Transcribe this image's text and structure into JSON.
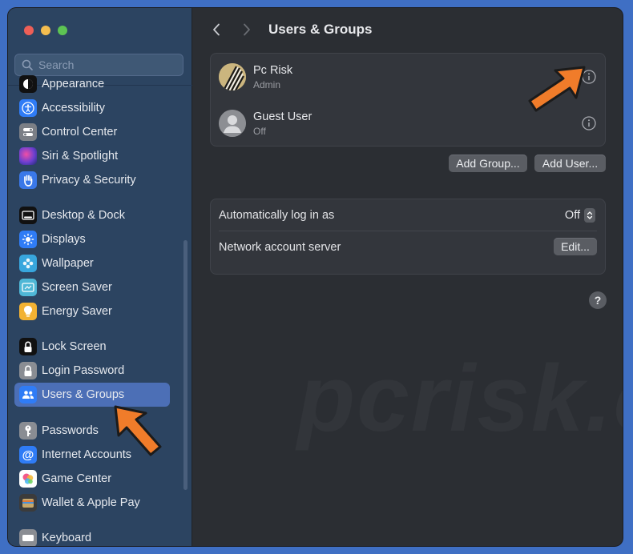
{
  "window": {
    "traffic_lights": [
      "close",
      "minimize",
      "zoom"
    ]
  },
  "sidebar": {
    "search_placeholder": "Search",
    "items": [
      {
        "label": "Appearance",
        "icon": "appearance-icon",
        "color": "#1b1b1b"
      },
      {
        "label": "Accessibility",
        "icon": "accessibility-icon",
        "color": "#2f7cf6"
      },
      {
        "label": "Control Center",
        "icon": "control-center-icon",
        "color": "#7b7f86"
      },
      {
        "label": "Siri & Spotlight",
        "icon": "siri-icon",
        "color": "#6b3fd0"
      },
      {
        "label": "Privacy & Security",
        "icon": "hand-icon",
        "color": "#3a78e8"
      },
      {
        "label": "Desktop & Dock",
        "icon": "dock-icon",
        "color": "#1b1b1b"
      },
      {
        "label": "Displays",
        "icon": "sun-icon",
        "color": "#2f7cf6"
      },
      {
        "label": "Wallpaper",
        "icon": "flower-icon",
        "color": "#38a6dd"
      },
      {
        "label": "Screen Saver",
        "icon": "screen-saver-icon",
        "color": "#4fb7d6"
      },
      {
        "label": "Energy Saver",
        "icon": "bulb-icon",
        "color": "#f2b233"
      },
      {
        "label": "Lock Screen",
        "icon": "lock-icon",
        "color": "#1b1b1b"
      },
      {
        "label": "Login Password",
        "icon": "padlock-icon",
        "color": "#8a8d93"
      },
      {
        "label": "Users & Groups",
        "icon": "users-icon",
        "color": "#2f7cf6"
      },
      {
        "label": "Passwords",
        "icon": "key-icon",
        "color": "#8a8d93"
      },
      {
        "label": "Internet Accounts",
        "icon": "at-icon",
        "color": "#2f7cf6"
      },
      {
        "label": "Game Center",
        "icon": "game-center-icon",
        "color": "#ffffff"
      },
      {
        "label": "Wallet & Apple Pay",
        "icon": "wallet-icon",
        "color": "#3b3b3b"
      },
      {
        "label": "Keyboard",
        "icon": "keyboard-icon",
        "color": "#8a8d93"
      }
    ],
    "active_item": "Users & Groups"
  },
  "header": {
    "title": "Users & Groups"
  },
  "users": [
    {
      "name": "Pc Risk",
      "role": "Admin"
    },
    {
      "name": "Guest User",
      "role": "Off"
    }
  ],
  "buttons": {
    "add_group": "Add Group...",
    "add_user": "Add User...",
    "edit": "Edit...",
    "help": "?"
  },
  "settings": {
    "auto_login_label": "Automatically log in as",
    "auto_login_value": "Off",
    "network_server_label": "Network account server"
  },
  "watermark": "pcrisk.com",
  "colors": {
    "accent": "#4c6fb6",
    "annotation_arrow": "#f07c2a"
  }
}
